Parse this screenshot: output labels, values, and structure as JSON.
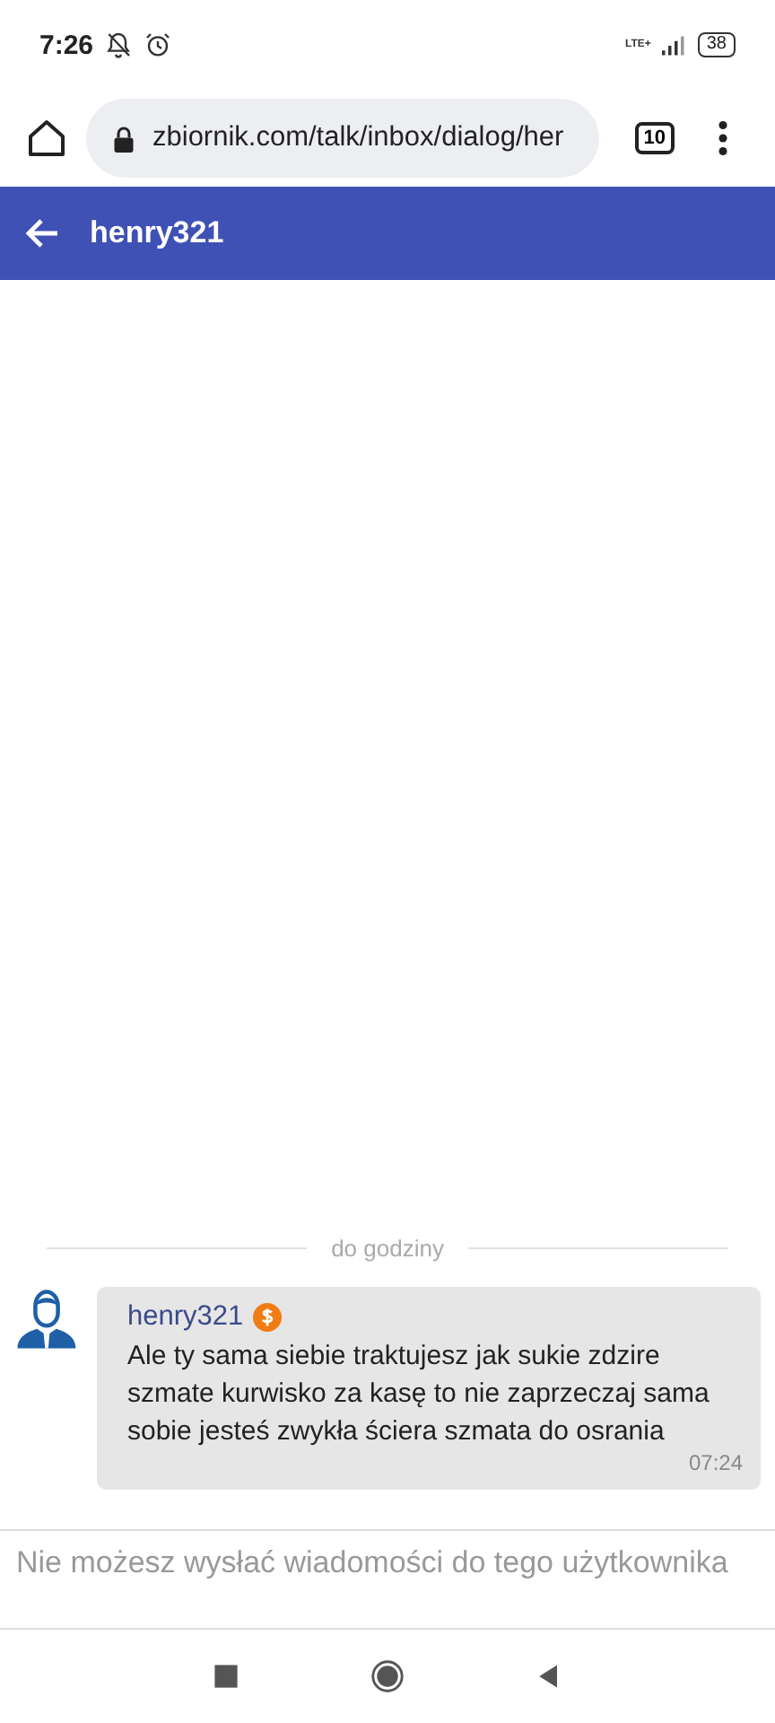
{
  "status_bar": {
    "time": "7:26",
    "network": "LTE+",
    "battery": "38"
  },
  "browser": {
    "url": "zbiornik.com/talk/inbox/dialog/her",
    "tab_count": "10"
  },
  "app_bar": {
    "title": "henry321"
  },
  "separator": {
    "label": "do godziny"
  },
  "messages": [
    {
      "author": "henry321",
      "premium": true,
      "text": "Ale ty sama siebie traktujesz jak sukie zdzire szmate kurwisko za kasę to nie zaprzeczaj sama sobie jesteś zwykła ściera szmata do osrania",
      "time": "07:24"
    }
  ],
  "composer": {
    "notice": "Nie możesz wysłać wiadomości do tego użytkownika"
  }
}
